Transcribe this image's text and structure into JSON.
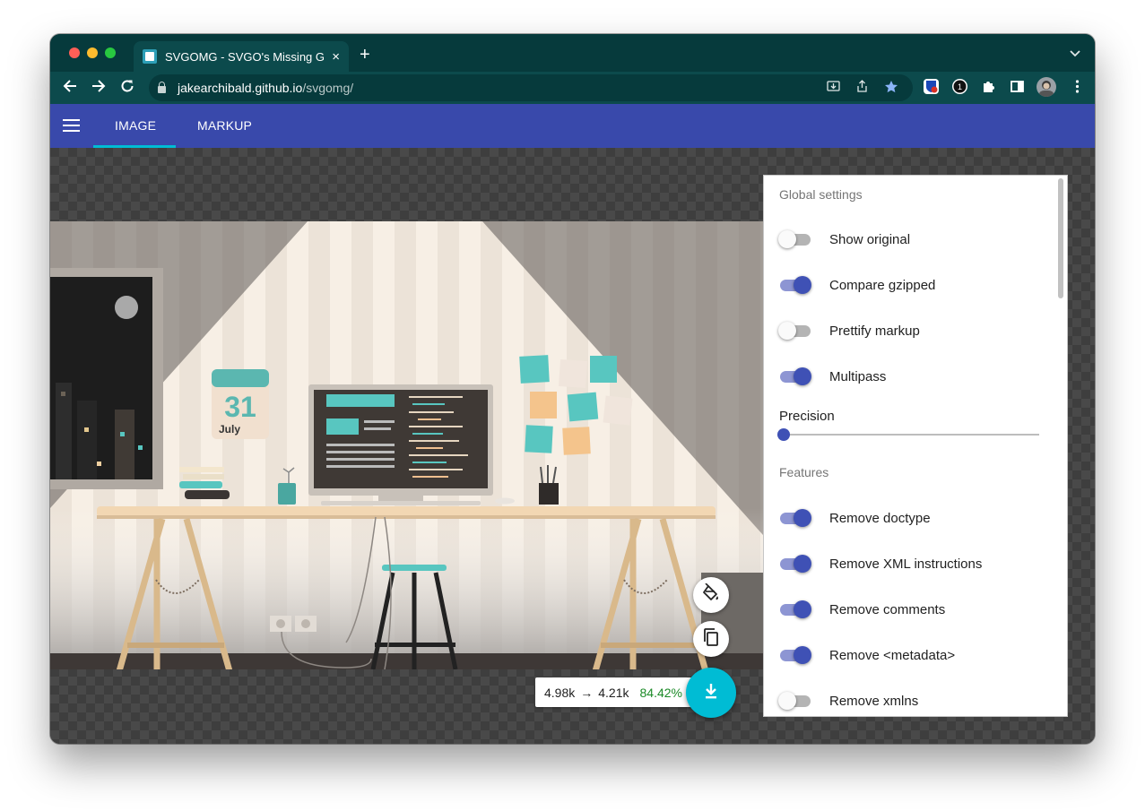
{
  "browser": {
    "tab_title": "SVGOMG - SVGO's Missing GUI",
    "url_host": "jakearchibald.github.io",
    "url_path": "/svgomg/",
    "new_tab": "+",
    "tab_close": "×"
  },
  "app": {
    "tabs": [
      {
        "label": "IMAGE",
        "active": true
      },
      {
        "label": "MARKUP",
        "active": false
      }
    ]
  },
  "illustration": {
    "calendar_day": "31",
    "calendar_month": "July"
  },
  "settings": {
    "global_title": "Global settings",
    "global": [
      {
        "label": "Show original",
        "on": false
      },
      {
        "label": "Compare gzipped",
        "on": true
      },
      {
        "label": "Prettify markup",
        "on": false
      },
      {
        "label": "Multipass",
        "on": true
      }
    ],
    "precision_label": "Precision",
    "precision_level": 0,
    "features_title": "Features",
    "features": [
      {
        "label": "Remove doctype",
        "on": true
      },
      {
        "label": "Remove XML instructions",
        "on": true
      },
      {
        "label": "Remove comments",
        "on": true
      },
      {
        "label": "Remove <metadata>",
        "on": true
      },
      {
        "label": "Remove xmlns",
        "on": false
      }
    ]
  },
  "result": {
    "original_size": "4.98k",
    "arrow": "→",
    "optimized_size": "4.21k",
    "saving": "84.42%"
  },
  "colors": {
    "accent": "#3949ab",
    "fab": "#00bcd4",
    "switch_on": "#3f51b5",
    "saving": "#1b8a27",
    "chrome_frame": "#063a3c"
  },
  "icons": [
    "back-arrow-icon",
    "forward-arrow-icon",
    "reload-icon",
    "lock-icon",
    "install-icon",
    "share-icon",
    "bookmark-star-icon",
    "extensions-puzzle-icon",
    "side-panel-icon",
    "menu-kebab-icon",
    "hamburger-menu-icon",
    "paint-bucket-icon",
    "copy-icon",
    "download-icon"
  ]
}
